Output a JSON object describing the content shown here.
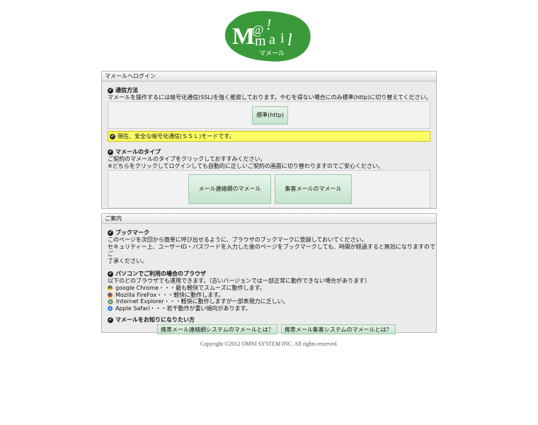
{
  "logo": {
    "main": "M@!mail",
    "sub": "マメール",
    "color": "#3a9a3a"
  },
  "login": {
    "header": "マメールへログイン",
    "comm": {
      "title": "通信方法",
      "desc": "マメールを操作するには暗号化通信(SSL)を強く推奨しております。やむを得ない場合にのみ標準(http)に切り替えてください。",
      "http_button": "標準(http)",
      "notice": "現在、安全な暗号化通信(ＳＳＬ)モードです。"
    },
    "type": {
      "title": "マメールのタイプ",
      "desc1": "ご契約のマメールのタイプをクリックしておすすみください。",
      "desc2": "※どちらをクリックしてログインしても自動的に正しいご契約の画面に切り替わりますのでご安心ください。",
      "btn_renraku": "メール連絡網のマメール",
      "btn_shukyaku": "集客メールのマメール"
    }
  },
  "guide": {
    "header": "ご案内",
    "bookmark": {
      "title": "ブックマーク",
      "line1": "このページを次回から簡単に呼び出せるように、ブラウザのブックマークに登録しておいてください。",
      "line2": "セキュリティー上、ユーザーID・パスワードを入力した後のページをブックマークしても、時間が経過すると無効になりますのでご",
      "line3": "了承ください。"
    },
    "browser": {
      "title": "パソコンでご利用の場合のブラウザ",
      "intro": "以下のどのブラウザでも運用できます。（古いバージョンでは一部正常に動作できない場合があります）",
      "items": [
        {
          "label": "google Chrome・・・最も軽快でスムーズに動作します。",
          "icon": "chrome-icon"
        },
        {
          "label": "Mozilla FireFox・・・軽快に動作します。",
          "icon": "firefox-icon"
        },
        {
          "label": "Internet Explorer・・・軽快に動作しますが一部表現力に乏しい。",
          "icon": "ie-icon"
        },
        {
          "label": "Apple Safari・・・若干動作が重い傾向があります。",
          "icon": "safari-icon"
        }
      ]
    },
    "about": {
      "title": "マメールをお知りになりたい方",
      "link1": "携帯メール連絡網システムのマメールとは？",
      "link2": "携帯メール集客システムのマメールとは？"
    }
  },
  "footer": "Copyright ©2012 OMNI SYSTEM INC. All rights reserved."
}
